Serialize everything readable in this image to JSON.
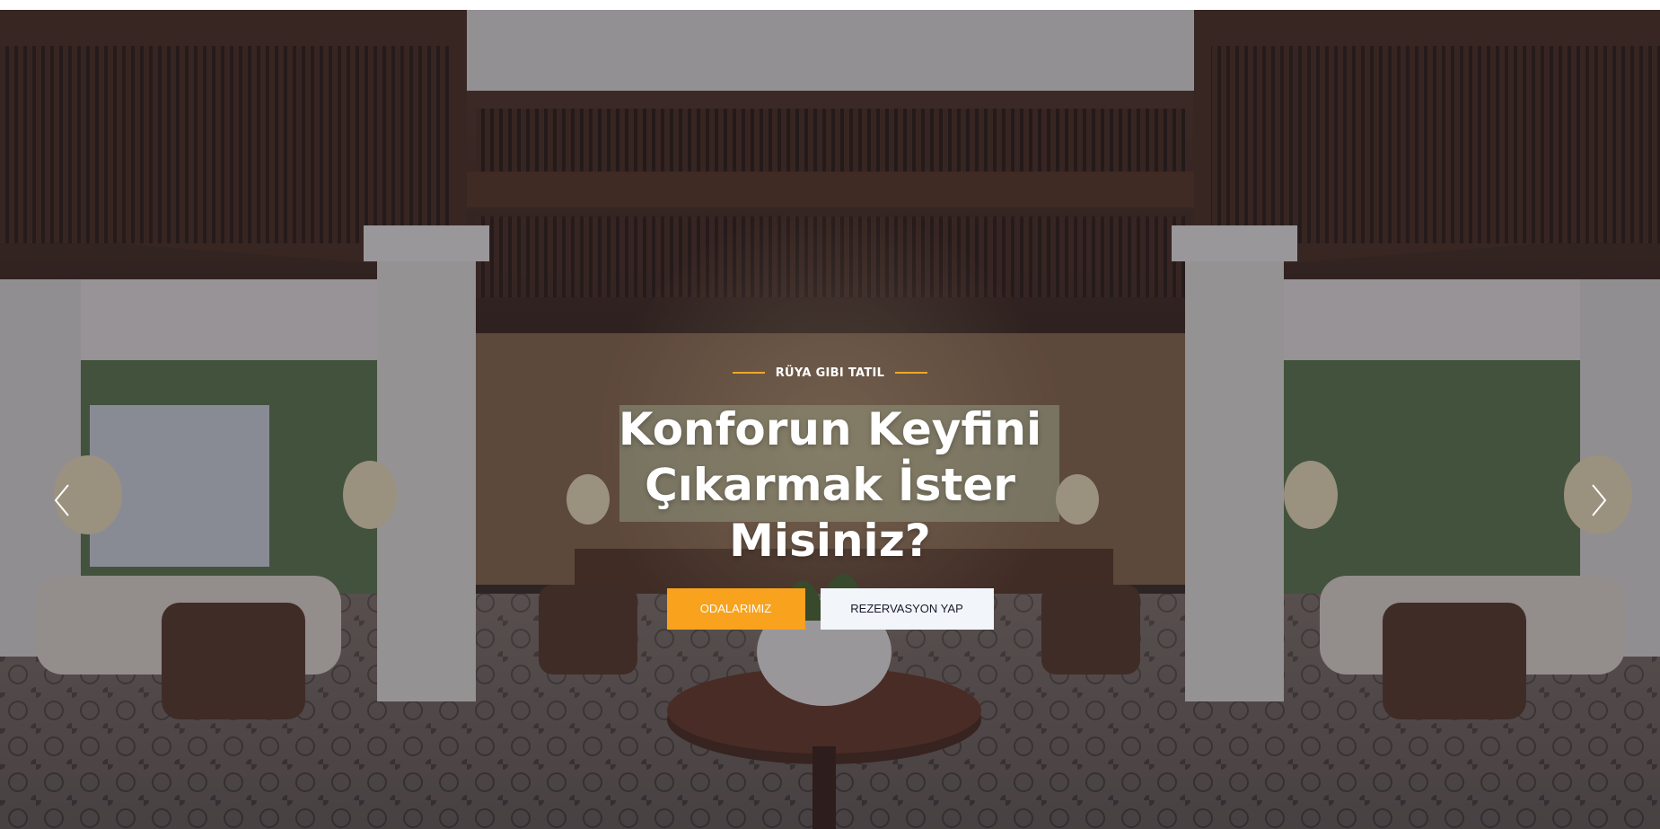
{
  "hero": {
    "eyebrow": "RÜYA GIBI TATIL",
    "headline_line1": "Konforun Keyfini",
    "headline_line2": "Çıkarmak İster",
    "headline_line3": "Misiniz?",
    "primary_button": "ODALARIMIZ",
    "secondary_button": "REZERVASYON YAP",
    "background_image": "hotel-lobby-photo",
    "prev_icon": "chevron-left-icon",
    "next_icon": "chevron-right-icon"
  },
  "colors": {
    "accent": "#f8a21d",
    "secondary_button_bg": "#f2f5fa",
    "overlay": "rgba(28,26,40,0.42)",
    "text": "#ffffff"
  }
}
